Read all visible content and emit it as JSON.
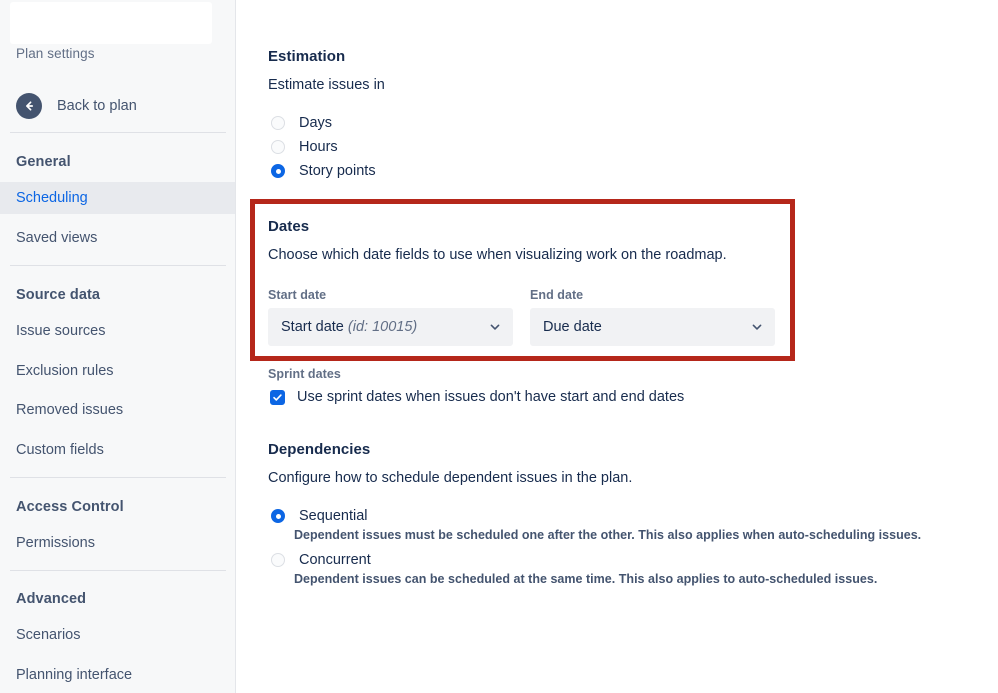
{
  "sidebar": {
    "plan_settings_label": "Plan settings",
    "back_label": "Back to plan",
    "back_icon": "arrow-left-circle-icon",
    "sections": [
      {
        "title": "General",
        "items": [
          {
            "label": "Scheduling",
            "active": true
          },
          {
            "label": "Saved views",
            "active": false
          }
        ]
      },
      {
        "title": "Source data",
        "items": [
          {
            "label": "Issue sources",
            "active": false
          },
          {
            "label": "Exclusion rules",
            "active": false
          },
          {
            "label": "Removed issues",
            "active": false
          },
          {
            "label": "Custom fields",
            "active": false
          }
        ]
      },
      {
        "title": "Access Control",
        "items": [
          {
            "label": "Permissions",
            "active": false
          }
        ]
      },
      {
        "title": "Advanced",
        "items": [
          {
            "label": "Scenarios",
            "active": false
          },
          {
            "label": "Planning interface",
            "active": false
          }
        ]
      }
    ]
  },
  "main": {
    "estimation": {
      "heading": "Estimation",
      "description": "Estimate issues in",
      "options": [
        {
          "label": "Days",
          "selected": false
        },
        {
          "label": "Hours",
          "selected": false
        },
        {
          "label": "Story points",
          "selected": true
        }
      ]
    },
    "dates": {
      "heading": "Dates",
      "description": "Choose which date fields to use when visualizing work on the roadmap.",
      "highlight_color": "#B5271A",
      "start_date": {
        "label": "Start date",
        "value": "Start date",
        "value_id": "(id: 10015)",
        "chevron_icon": "chevron-down-icon"
      },
      "end_date": {
        "label": "End date",
        "value": "Due date",
        "value_id": "",
        "chevron_icon": "chevron-down-icon"
      }
    },
    "sprint_dates": {
      "label": "Sprint dates",
      "checkbox_label": "Use sprint dates when issues don't have start and end dates",
      "checked": true,
      "check_icon": "check-icon"
    },
    "dependencies": {
      "heading": "Dependencies",
      "description": "Configure how to schedule dependent issues in the plan.",
      "options": [
        {
          "label": "Sequential",
          "selected": true,
          "sub": "Dependent issues must be scheduled one after the other. This also applies when auto-scheduling issues."
        },
        {
          "label": "Concurrent",
          "selected": false,
          "sub": "Dependent issues can be scheduled at the same time. This also applies to auto-scheduled issues."
        }
      ]
    }
  },
  "colors": {
    "accent_blue": "#0C66E4",
    "highlight_red": "#B5271A",
    "sidebar_bg": "#F7F8F9",
    "active_item_bg": "#E8EAEE",
    "text_primary": "#172B4D",
    "text_subtle": "#626F86"
  }
}
